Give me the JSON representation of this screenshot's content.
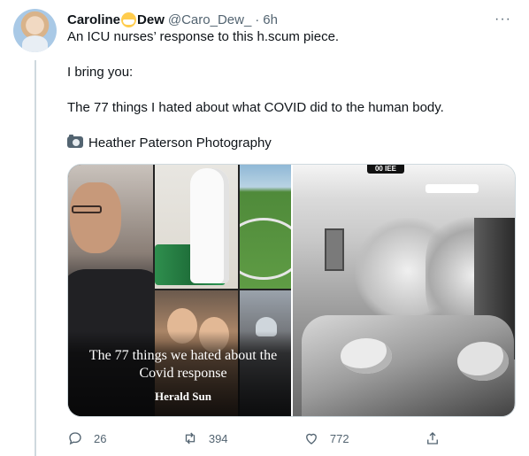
{
  "tweet": {
    "author": {
      "name_part1": "Caroline",
      "name_part2": "Dew",
      "handle": "@Caro_Dew_",
      "separator": "·",
      "time": "6h"
    },
    "more_label": "···",
    "lines": [
      "An ICU nurses’ response to this h.scum piece.",
      "I bring you:",
      "The 77 things I hated about what COVID did to the human body.",
      "Heather Paterson Photography"
    ],
    "media": {
      "headline": "The 77 things we hated about the Covid response",
      "brand": "Herald Sun",
      "sign_text": "00 IEE"
    },
    "actions": {
      "reply_count": "26",
      "retweet_count": "394",
      "like_count": "772"
    }
  },
  "colors": {
    "text": "#0f1419",
    "secondary": "#536471",
    "border": "#cfd9de"
  },
  "icons": [
    "more-icon",
    "mask-emoji-icon",
    "camera-icon",
    "reply-icon",
    "retweet-icon",
    "like-icon",
    "share-icon"
  ]
}
